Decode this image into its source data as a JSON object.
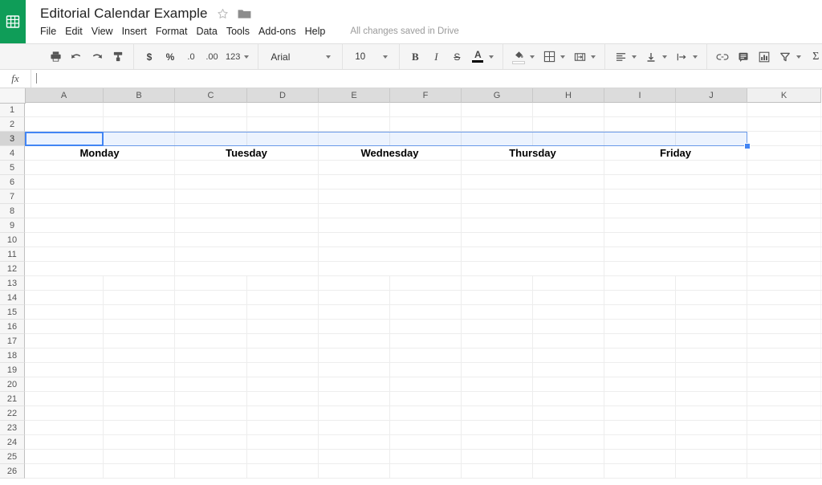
{
  "app": {
    "logo_icon": "sheets-grid-icon",
    "brand_color": "#0f9d58"
  },
  "header": {
    "doc_title": "Editorial Calendar Example",
    "star_icon": "star-outline-icon",
    "folder_icon": "folder-icon",
    "menus": [
      "File",
      "Edit",
      "View",
      "Insert",
      "Format",
      "Data",
      "Tools",
      "Add-ons",
      "Help"
    ],
    "save_status": "All changes saved in Drive"
  },
  "toolbar": {
    "groups": [
      {
        "name": "history",
        "items": [
          {
            "icon": "print-icon",
            "label": ""
          },
          {
            "icon": "undo-icon",
            "label": ""
          },
          {
            "icon": "redo-icon",
            "label": ""
          },
          {
            "icon": "paint-format-icon",
            "label": ""
          }
        ]
      },
      {
        "name": "number-format",
        "items": [
          {
            "icon": "currency-icon",
            "label": "$"
          },
          {
            "icon": "percent-icon",
            "label": "%"
          },
          {
            "icon": "decrease-decimal-icon",
            "label": ".0"
          },
          {
            "icon": "increase-decimal-icon",
            "label": ".00"
          },
          {
            "icon": "more-formats-icon",
            "label": "123"
          }
        ]
      }
    ],
    "font_family": "Arial",
    "font_size": "10",
    "bold_label": "B",
    "italic_label": "I",
    "strikethrough_label": "S",
    "text_color_label": "A",
    "text_color": "#000000",
    "fill_color": "#ffffff",
    "icons": {
      "fill_color": "fill-color-icon",
      "borders": "borders-icon",
      "merge_cells": "merge-cells-icon",
      "horizontal_align": "horizontal-align-icon",
      "vertical_align": "vertical-align-icon",
      "text_wrap": "text-wrap-icon",
      "insert_link": "link-icon",
      "insert_comment": "comment-icon",
      "insert_chart": "chart-icon",
      "filter": "filter-icon",
      "functions": "sigma-icon"
    }
  },
  "formula_bar": {
    "fx_label": "fx",
    "value": "",
    "placeholder": ""
  },
  "grid": {
    "columns": [
      {
        "label": "A",
        "width": 98,
        "active": true
      },
      {
        "label": "B",
        "width": 89,
        "active": true
      },
      {
        "label": "C",
        "width": 90,
        "active": true
      },
      {
        "label": "D",
        "width": 89,
        "active": true
      },
      {
        "label": "E",
        "width": 89,
        "active": true
      },
      {
        "label": "F",
        "width": 89,
        "active": true
      },
      {
        "label": "G",
        "width": 89,
        "active": true
      },
      {
        "label": "H",
        "width": 89,
        "active": true
      },
      {
        "label": "I",
        "width": 89,
        "active": true
      },
      {
        "label": "J",
        "width": 89,
        "active": true
      },
      {
        "label": "K",
        "width": 92,
        "active": false
      }
    ],
    "rows": [
      "1",
      "2",
      "3",
      "4",
      "5",
      "6",
      "7",
      "8",
      "9",
      "10",
      "11",
      "12",
      "13",
      "14",
      "15",
      "16",
      "17",
      "18",
      "19",
      "20",
      "21",
      "22",
      "23",
      "24",
      "25",
      "26"
    ],
    "active_row": "3",
    "selection": {
      "range": "A3:J3",
      "active_cell": "A3",
      "fill_handle": true
    },
    "day_headers": [
      {
        "row": "4",
        "label": "Monday",
        "columns": "A:B"
      },
      {
        "row": "4",
        "label": "Tuesday",
        "columns": "C:D"
      },
      {
        "row": "4",
        "label": "Wednesday",
        "columns": "E:F"
      },
      {
        "row": "4",
        "label": "Thursday",
        "columns": "G:H"
      },
      {
        "row": "4",
        "label": "Friday",
        "columns": "I:J"
      }
    ],
    "merged_rows_start": "4",
    "merged_rows_end": "12"
  }
}
